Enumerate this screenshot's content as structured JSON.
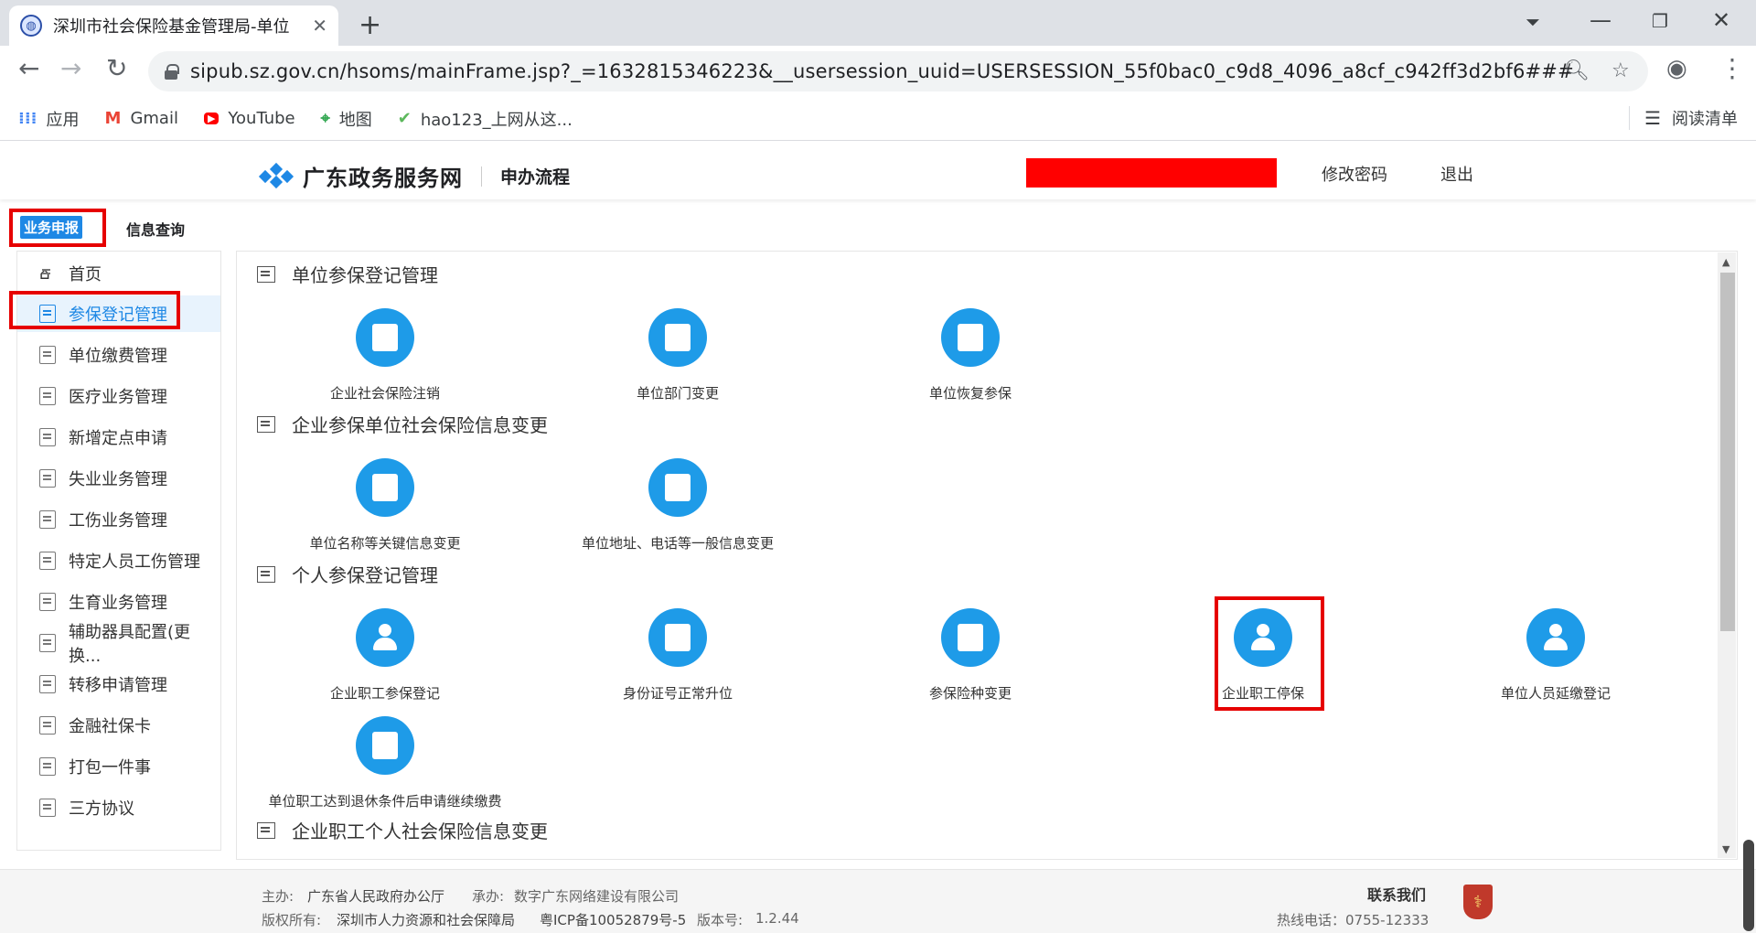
{
  "browser": {
    "tab_title": "深圳市社会保险基金管理局-单位",
    "url": "sipub.sz.gov.cn/hsoms/mainFrame.jsp?_=1632815346223&__usersession_uuid=USERSESSION_55f0bac0_c9d8_4096_a8cf_c942ff3d2bf6###",
    "bookmarks": [
      {
        "label": "应用",
        "icon": "apps-grid-icon"
      },
      {
        "label": "Gmail",
        "icon": "gmail-icon"
      },
      {
        "label": "YouTube",
        "icon": "youtube-icon"
      },
      {
        "label": "地图",
        "icon": "maps-icon"
      },
      {
        "label": "hao123_上网从这...",
        "icon": "hao123-icon"
      }
    ],
    "reading_list": "阅读清单"
  },
  "site": {
    "name": "广东政务服务网",
    "section": "申办流程",
    "change_password": "修改密码",
    "logout": "退出"
  },
  "top_tabs": [
    "业务申报",
    "信息查询"
  ],
  "sidebar": {
    "items": [
      "首页",
      "参保登记管理",
      "单位缴费管理",
      "医疗业务管理",
      "新增定点申请",
      "失业业务管理",
      "工伤业务管理",
      "特定人员工伤管理",
      "生育业务管理",
      "辅助器具配置(更换...",
      "转移申请管理",
      "金融社保卡",
      "打包一件事",
      "三方协议"
    ],
    "active_index": 1
  },
  "sections": [
    {
      "title": "单位参保登记管理",
      "cards": [
        "企业社会保险注销",
        "单位部门变更",
        "单位恢复参保"
      ]
    },
    {
      "title": "企业参保单位社会保险信息变更",
      "cards": [
        "单位名称等关键信息变更",
        "单位地址、电话等一般信息变更"
      ]
    },
    {
      "title": "个人参保登记管理",
      "cards": [
        "企业职工参保登记",
        "身份证号正常升位",
        "参保险种变更",
        "企业职工停保",
        "单位人员延缴登记",
        "单位职工达到退休条件后申请继续缴费"
      ]
    },
    {
      "title": "企业职工个人社会保险信息变更",
      "cards": []
    }
  ],
  "footer": {
    "host_label": "主办:",
    "host": "广东省人民政府办公厅",
    "undertake_label": "承办:",
    "undertake": "数字广东网络建设有限公司",
    "copyright_label": "版权所有:",
    "copyright": "深圳市人力资源和社会保障局",
    "icp": "粤ICP备10052879号-5",
    "version_label": "版本号:",
    "version": "1.2.44",
    "contact": "联系我们",
    "hotline": "热线电话：0755-12333"
  },
  "colors": {
    "accent": "#1e9be8",
    "highlight_box": "#e60000",
    "redaction": "#ff0000"
  }
}
